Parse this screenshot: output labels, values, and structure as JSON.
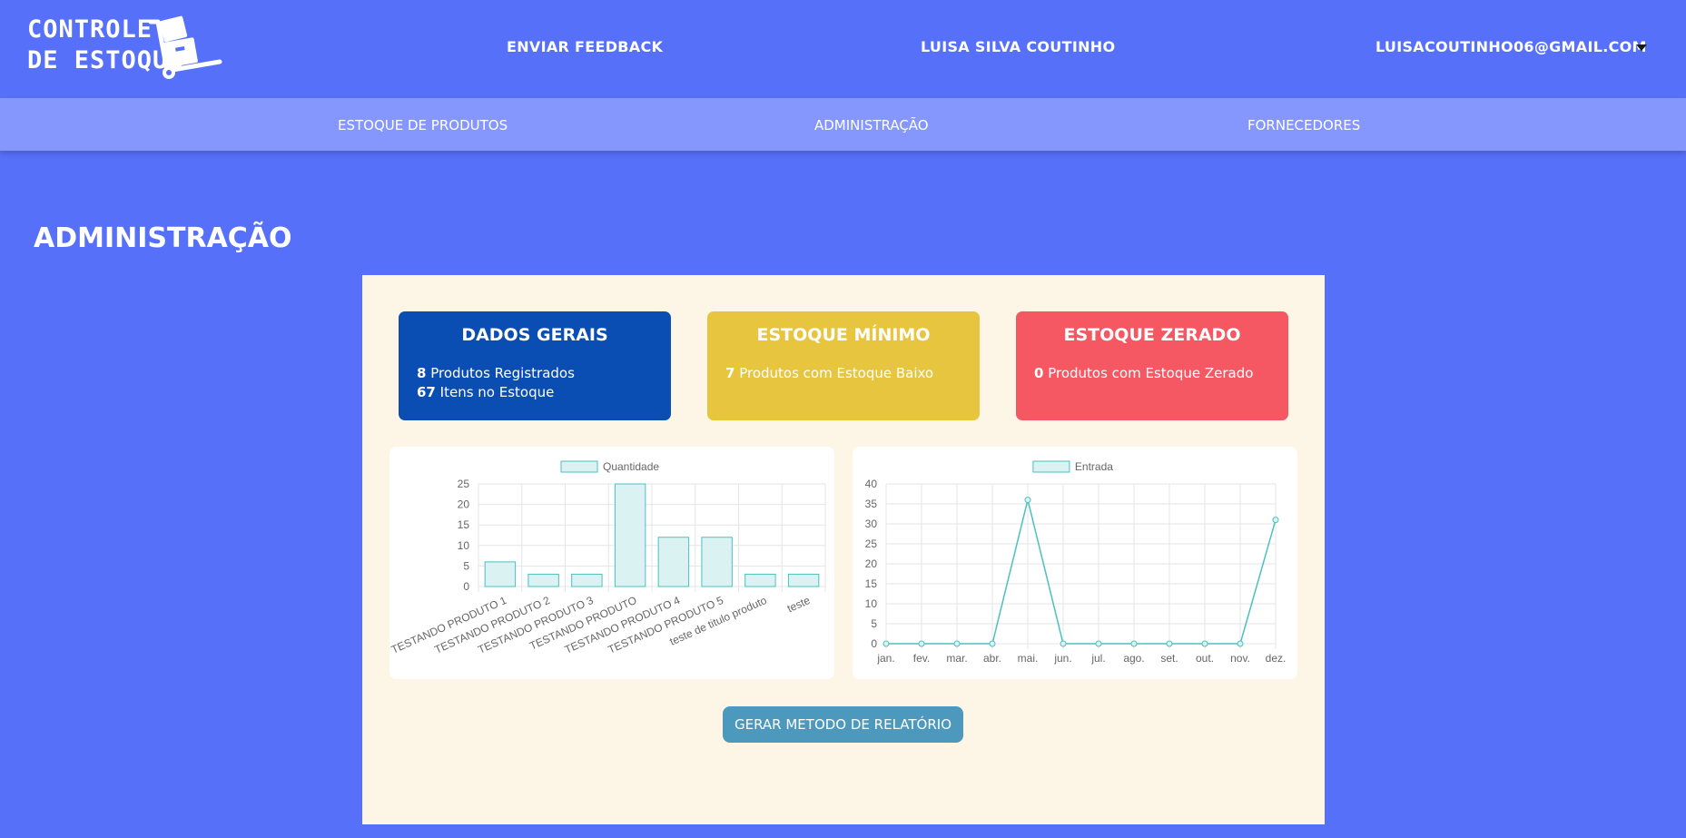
{
  "header": {
    "logo_line1": "CONTROLE",
    "logo_line2": "DE ESTOQUE",
    "feedback_link": "ENVIAR FEEDBACK",
    "user_name": "LUISA SILVA COUTINHO",
    "user_email": "LUISACOUTINHO06@GMAIL.COM"
  },
  "subnav": {
    "items": [
      {
        "label": "ESTOQUE DE PRODUTOS"
      },
      {
        "label": "ADMINISTRAÇÃO"
      },
      {
        "label": "FORNECEDORES"
      }
    ]
  },
  "page": {
    "title": "ADMINISTRAÇÃO"
  },
  "cards": [
    {
      "title": "DADOS GERAIS",
      "color": "#0b4eb3",
      "lines": [
        {
          "value": "8",
          "text": "Produtos Registrados"
        },
        {
          "value": "67",
          "text": "Itens no Estoque"
        }
      ]
    },
    {
      "title": "ESTOQUE MÍNIMO",
      "color": "#e7c53f",
      "lines": [
        {
          "value": "7",
          "text": "Produtos com Estoque Baixo"
        }
      ]
    },
    {
      "title": "ESTOQUE ZERADO",
      "color": "#f65863",
      "lines": [
        {
          "value": "0",
          "text": "Produtos com Estoque Zerado"
        }
      ]
    }
  ],
  "chart_data": [
    {
      "type": "bar",
      "categories": [
        "TESTANDO PRODUTO 1",
        "TESTANDO PRODUTO 2",
        "TESTANDO PRODUTO 3",
        "TESTANDO PRODUTO",
        "TESTANDO PRODUTO 4",
        "TESTANDO PRODUTO 5",
        "teste de titulo produto",
        "teste"
      ],
      "series": [
        {
          "name": "Quantidade",
          "values": [
            6,
            3,
            3,
            25,
            12,
            12,
            3,
            3
          ]
        }
      ],
      "ylim": [
        0,
        25
      ],
      "yticks": [
        0,
        5,
        10,
        15,
        20,
        25
      ],
      "grid": true,
      "legend": "top",
      "fill_color": "#dbf2f2",
      "stroke_color": "#4bc0c0"
    },
    {
      "type": "line",
      "categories": [
        "jan.",
        "fev.",
        "mar.",
        "abr.",
        "mai.",
        "jun.",
        "jul.",
        "ago.",
        "set.",
        "out.",
        "nov.",
        "dez."
      ],
      "series": [
        {
          "name": "Entrada",
          "values": [
            0,
            0,
            0,
            0,
            36,
            0,
            0,
            0,
            0,
            0,
            0,
            31
          ]
        }
      ],
      "ylim": [
        0,
        40
      ],
      "yticks": [
        0,
        5,
        10,
        15,
        20,
        25,
        30,
        35,
        40
      ],
      "grid": true,
      "legend": "top",
      "fill_color": "#dbf2f2",
      "stroke_color": "#4bc0c0"
    }
  ],
  "actions": {
    "report_button": "GERAR METODO DE RELATÓRIO"
  }
}
